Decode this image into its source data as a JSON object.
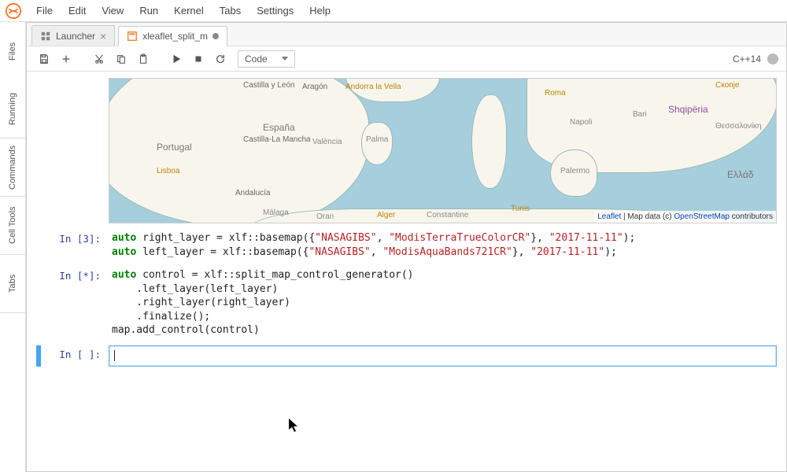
{
  "menu": {
    "items": [
      "File",
      "Edit",
      "View",
      "Run",
      "Kernel",
      "Tabs",
      "Settings",
      "Help"
    ]
  },
  "sidebar": {
    "tabs": [
      "Files",
      "Running",
      "Commands",
      "Cell Tools",
      "Tabs"
    ]
  },
  "tabs": [
    {
      "label": "Launcher",
      "active": false,
      "closable": true,
      "dirty": false
    },
    {
      "label": "xleaflet_split_m",
      "active": true,
      "closable": false,
      "dirty": true
    }
  ],
  "toolbar": {
    "cell_type": "Code",
    "kernel_name": "C++14"
  },
  "map": {
    "attr_prefix": "Leaflet",
    "attr_mid": " | Map data (c) ",
    "attr_link": "OpenStreetMap",
    "attr_suffix": " contributors",
    "labels": {
      "portugal": "Portugal",
      "espana": "España",
      "lisboa": "Lisboa",
      "andalucia": "Andalucía",
      "malaga": "Málaga",
      "valencia": "València",
      "aragon": "Aragón",
      "castilla_leon": "Castilla y León",
      "castilla_mancha": "Castilla-La Mancha",
      "andorra": "Andorra la Vella",
      "palma": "Palma",
      "oran": "Oran",
      "alger": "Alger",
      "constantine": "Constantine",
      "tunis": "Tunis",
      "napoli": "Napoli",
      "bari": "Bari",
      "palermo": "Palermo",
      "roma": "Roma",
      "shqiperia": "Shqipëria",
      "skopje": "Скопје",
      "thessaloniki": "Θεσσαλονίκη",
      "ellada": "Ελλάδ"
    }
  },
  "cells": [
    {
      "prompt": "In [3]:",
      "code_html": "<span class='kw'>auto</span> right_layer = xlf::basemap({<span class='str'>\"NASAGIBS\"</span>, <span class='str'>\"ModisTerraTrueColorCR\"</span>}, <span class='str'>\"2017-11-11\"</span>);\n<span class='kw'>auto</span> left_layer = xlf::basemap({<span class='str'>\"NASAGIBS\"</span>, <span class='str'>\"ModisAquaBands721CR\"</span>}, <span class='str'>\"2017-11-11\"</span>);"
    },
    {
      "prompt": "In [*]:",
      "code_html": "<span class='kw'>auto</span> control = xlf::split_map_control_generator()\n    .left_layer(left_layer)\n    .right_layer(right_layer)\n    .finalize();\nmap.add_control(control)"
    },
    {
      "prompt": "In [ ]:",
      "code_html": ""
    }
  ]
}
